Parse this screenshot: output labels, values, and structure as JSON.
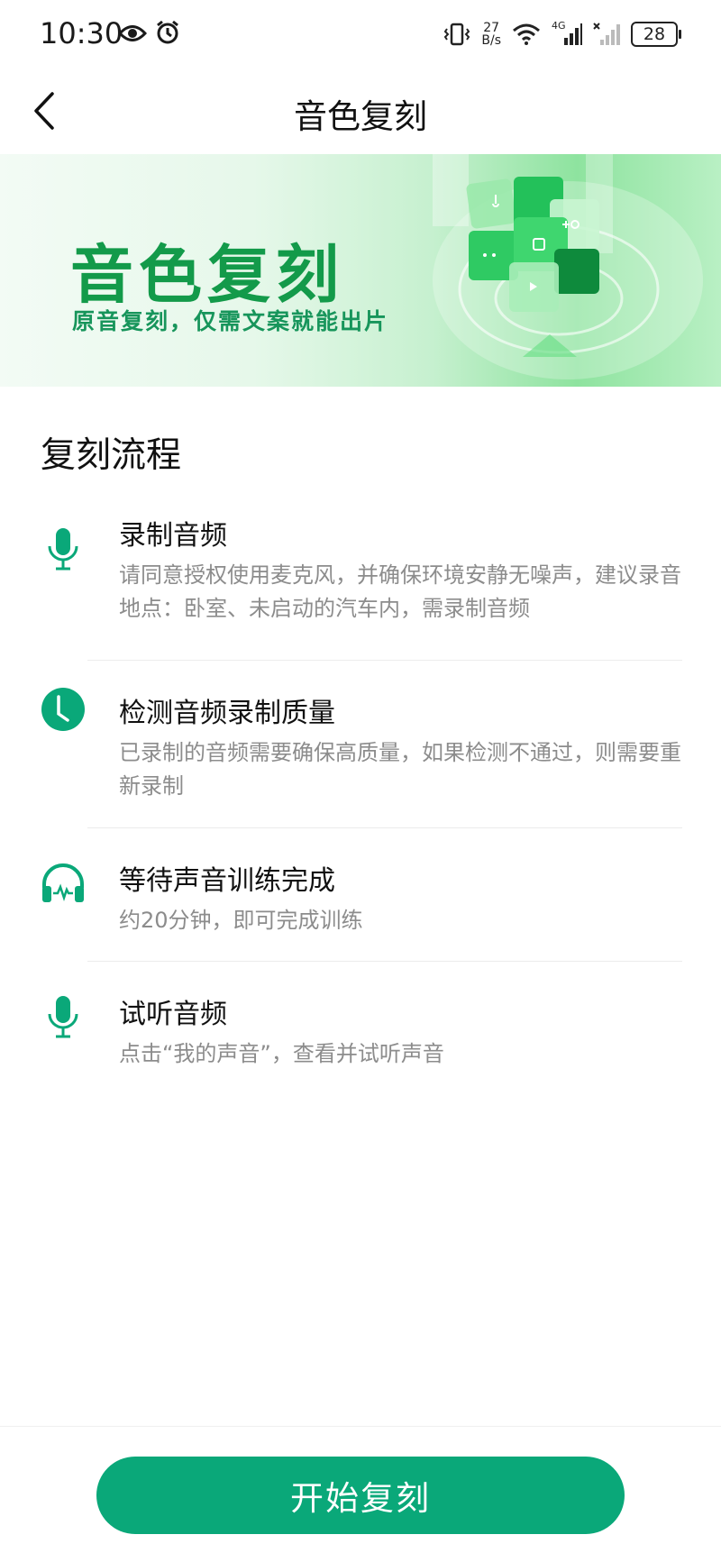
{
  "status_bar": {
    "time": "10:30",
    "net_speed_value": "27",
    "net_speed_unit": "B/s",
    "network_type": "4G",
    "battery": "28"
  },
  "nav": {
    "title": "音色复刻"
  },
  "banner": {
    "title": "音色复刻",
    "subtitle": "原音复刻，仅需文案就能出片"
  },
  "process": {
    "title": "复刻流程",
    "steps": [
      {
        "icon": "microphone-icon",
        "title": "录制音频",
        "description": "请同意授权使用麦克风，并确保环境安静无噪声，建议录音地点：卧室、未启动的汽车内，需录制音频"
      },
      {
        "icon": "clock-icon",
        "title": "检测音频录制质量",
        "description": "已录制的音频需要确保高质量，如果检测不通过，则需要重新录制"
      },
      {
        "icon": "headphones-icon",
        "title": "等待声音训练完成",
        "description": "约20分钟，即可完成训练"
      },
      {
        "icon": "microphone-icon",
        "title": "试听音频",
        "description": "点击“我的声音”，查看并试听声音"
      }
    ]
  },
  "action": {
    "start_label": "开始复刻"
  },
  "colors": {
    "accent": "#0aa879",
    "brand_green": "#139a4a",
    "text_secondary": "#8c8c8c"
  }
}
